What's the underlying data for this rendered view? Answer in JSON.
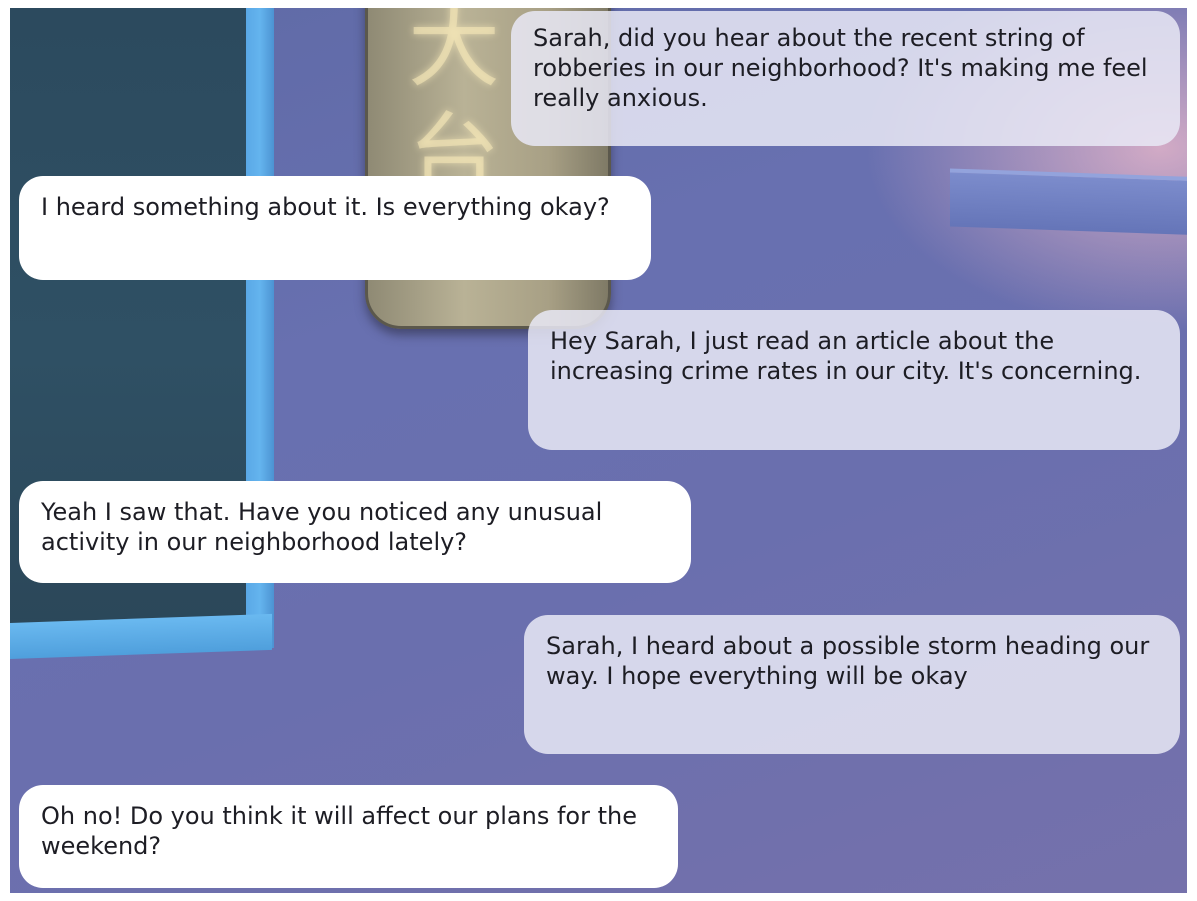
{
  "messages": [
    {
      "side": "right",
      "text": "Sarah, did you hear about the recent string of robberies in our neighborhood? It's making me feel really anxious."
    },
    {
      "side": "left",
      "text": "I heard something about it. Is everything okay?"
    },
    {
      "side": "right",
      "text": "Hey Sarah, I just read an article about the increasing crime rates in our city. It's concerning."
    },
    {
      "side": "left",
      "text": "Yeah I saw that. Have you noticed any unusual activity in our neighborhood lately?"
    },
    {
      "side": "right",
      "text": "Sarah, I heard about a possible storm heading our way. I hope everything will be okay"
    },
    {
      "side": "left",
      "text": "Oh no! Do you think it will affect our plans for the weekend?"
    }
  ]
}
